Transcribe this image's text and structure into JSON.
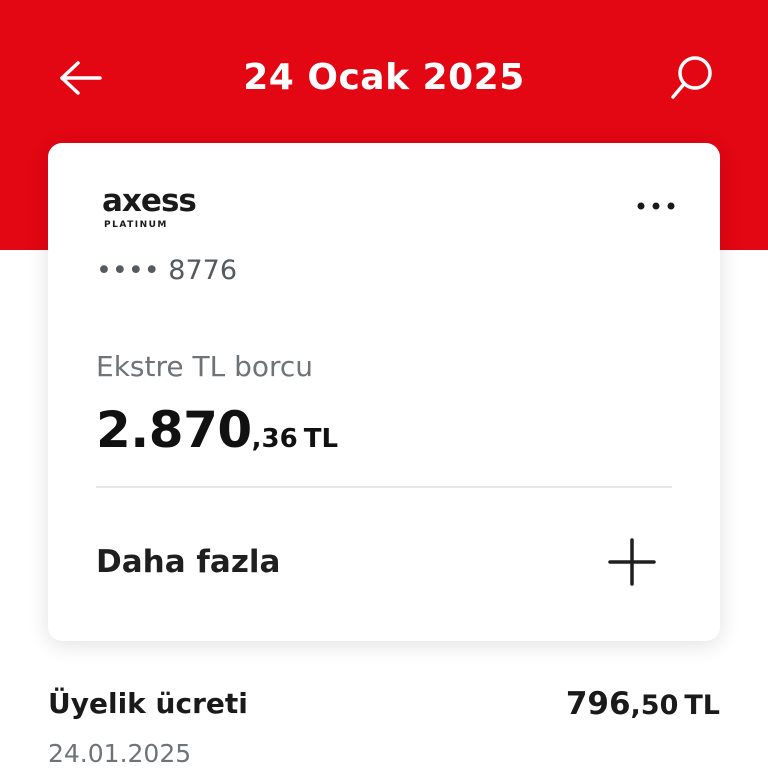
{
  "header": {
    "title": "24 Ocak 2025",
    "background_color": "#e30613",
    "back_icon": "arrow-left-icon",
    "search_icon": "search-icon"
  },
  "card": {
    "brand_name": "axess",
    "brand_tier": "PLATINUM",
    "more_icon": "ellipsis-icon",
    "masked_number": "•••• 8776",
    "balance_label": "Ekstre TL borcu",
    "balance_main": "2.870",
    "balance_fraction": ",36",
    "balance_currency": "TL",
    "more_label": "Daha fazla",
    "expand_icon": "plus-icon"
  },
  "transaction": {
    "title": "Üyelik ücreti",
    "amount_main": "796",
    "amount_fraction": ",50",
    "amount_currency": "TL",
    "date": "24.01.2025"
  }
}
